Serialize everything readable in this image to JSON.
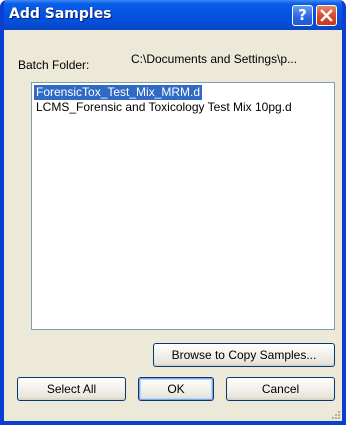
{
  "window": {
    "title": "Add Samples",
    "help_label": "?",
    "close_label": "✕"
  },
  "batch": {
    "label": "Batch Folder:",
    "path": "C:\\Documents and Settings\\p..."
  },
  "samples": {
    "items": [
      {
        "label": "ForensicTox_Test_Mix_MRM.d",
        "selected": true
      },
      {
        "label": "LCMS_Forensic and Toxicology Test Mix 10pg.d",
        "selected": false
      }
    ]
  },
  "buttons": {
    "browse": "Browse to Copy Samples...",
    "select_all": "Select All",
    "ok": "OK",
    "cancel": "Cancel"
  },
  "colors": {
    "titlebar": "#0452e1",
    "selection": "#316ac5",
    "dialog_bg": "#ece9d8"
  }
}
